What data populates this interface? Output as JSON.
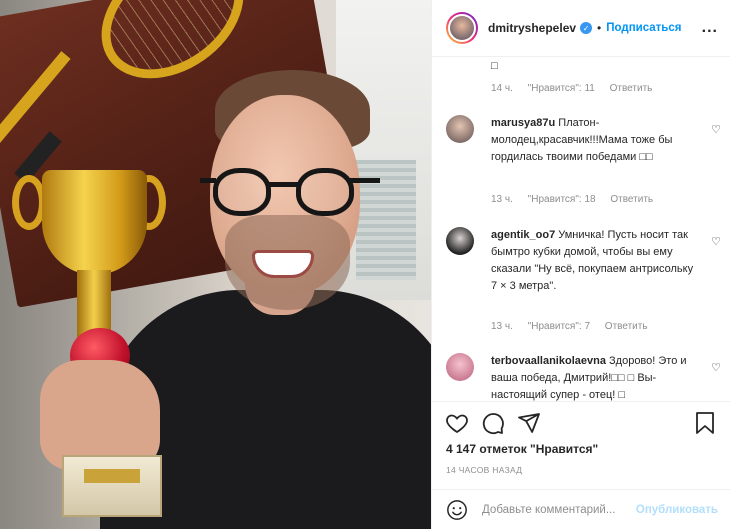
{
  "post": {
    "username": "dmitryshepelev",
    "verified_icon": "verified-badge-icon",
    "separator": "•",
    "follow_label": "Подписаться",
    "more_label": "..."
  },
  "comments": {
    "previous_tail": "□",
    "previous_meta": {
      "time": "14 ч.",
      "likes": "\"Нравится\": 11",
      "reply": "Ответить"
    },
    "items": [
      {
        "username": "marusya87u",
        "text": "Платон-молодец,красавчик!!!Мама тоже бы гордилась твоими победами □□",
        "time": "13 ч.",
        "likes": "\"Нравится\": 18",
        "reply": "Ответить"
      },
      {
        "username": "agentik_oo7",
        "text": "Умничка! Пусть носит так бымтро кубки домой, чтобы вы ему сказали \"Ну всё, покупаем антрисольку 7 × 3 метра\".",
        "time": "13 ч.",
        "likes": "\"Нравится\": 7",
        "reply": "Ответить"
      },
      {
        "username": "terbovaallanikolaevna",
        "text": "Здорово! Это и ваша победа, Дмитрий!□□ □ Вы-настоящий супер - отец! □"
      }
    ]
  },
  "actions": {
    "icons": [
      "heart-icon",
      "comment-icon",
      "share-icon",
      "bookmark-icon"
    ]
  },
  "likes_text": "4 147 отметок \"Нравится\"",
  "timestamp": "14 ЧАСОВ НАЗАД",
  "add_comment": {
    "placeholder": "Добавьте комментарий...",
    "publish_label": "Опубликовать"
  },
  "colors": {
    "accent": "#0095f6",
    "publish_disabled": "#b2dffc",
    "muted": "#8e8e8e",
    "text": "#262626"
  }
}
